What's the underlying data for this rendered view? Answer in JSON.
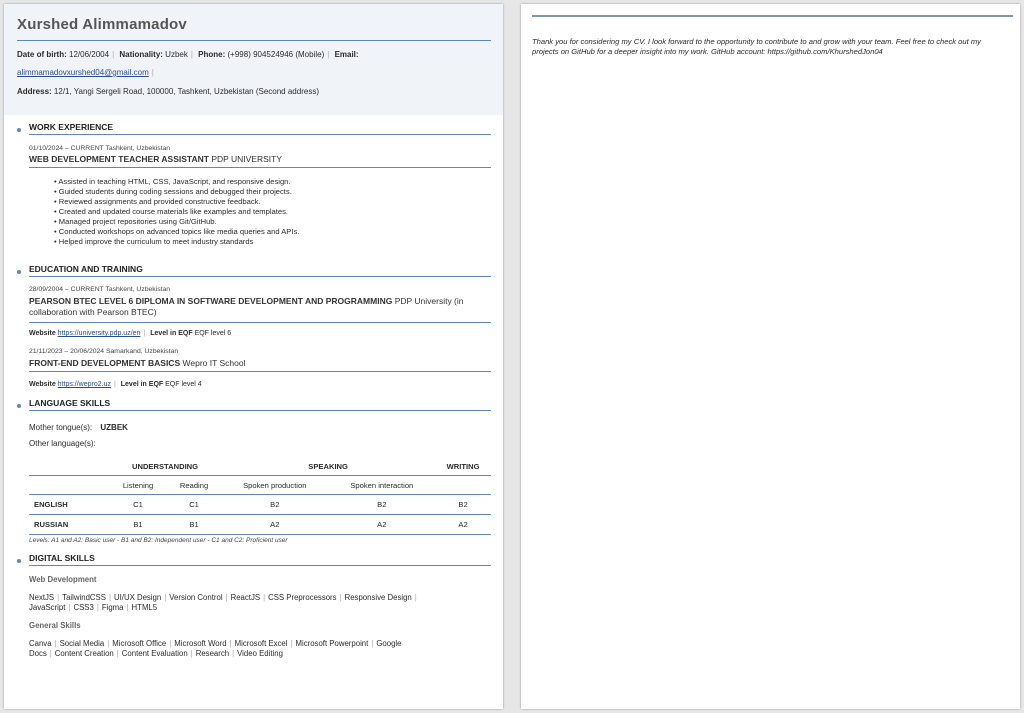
{
  "header": {
    "name": "Xurshed Alimmamadov",
    "dob_label": "Date of birth:",
    "dob": "12/06/2004",
    "nationality_label": "Nationality:",
    "nationality": "Uzbek",
    "phone_label": "Phone:",
    "phone": "(+998) 904524946 (Mobile)",
    "email_label": "Email:",
    "email": "alimmamadovxurshed04@gmail.com",
    "address_label": "Address:",
    "address": "12/1, Yangi Sergeli Road, 100000, Tashkent, Uzbekistan (Second address)"
  },
  "work": {
    "heading": "WORK EXPERIENCE",
    "date_place": "01/10/2024 – CURRENT Tashkent, Uzbekistan",
    "title": "WEB DEVELOPMENT TEACHER ASSISTANT",
    "org": "PDP UNIVERSITY",
    "bullets": [
      "Assisted in teaching HTML, CSS, JavaScript, and responsive design.",
      "Guided students during coding sessions and debugged their projects.",
      "Reviewed assignments and provided constructive feedback.",
      "Created and updated course materials like examples and templates.",
      "Managed project repositories using Git/GitHub.",
      "Conducted workshops on advanced topics like media queries and APIs.",
      "Helped improve the curriculum to meet industry standards"
    ]
  },
  "education": {
    "heading": "EDUCATION AND TRAINING",
    "items": [
      {
        "date_place": "28/09/2004 – CURRENT Tashkent, Uzbekistan",
        "title": "PEARSON BTEC LEVEL 6 DIPLOMA IN SOFTWARE DEVELOPMENT AND PROGRAMMING",
        "org_line1": "PDP University (in",
        "org_line2": "collaboration with Pearson BTEC)",
        "website_label": "Website",
        "website": "https://university.pdp.uz/en",
        "eqf_label": "Level in EQF",
        "eqf": "EQF level 6"
      },
      {
        "date_place": "21/11/2023 – 20/06/2024 Samarkand, Uzbekistan",
        "title": "FRONT-END DEVELOPMENT BASICS",
        "org": "Wepro IT School",
        "website_label": "Website",
        "website": "https://wepro2.uz",
        "eqf_label": "Level in EQF",
        "eqf": "EQF level 4"
      }
    ]
  },
  "languages": {
    "heading": "LANGUAGE SKILLS",
    "mother_label": "Mother tongue(s):",
    "mother": "UZBEK",
    "other_label": "Other language(s):",
    "groups": [
      "UNDERSTANDING",
      "SPEAKING",
      "WRITING"
    ],
    "subheads": [
      "Listening",
      "Reading",
      "Spoken production",
      "Spoken interaction"
    ],
    "rows": [
      {
        "lang": "ENGLISH",
        "values": [
          "C1",
          "C1",
          "B2",
          "B2",
          "B2"
        ]
      },
      {
        "lang": "RUSSIAN",
        "values": [
          "B1",
          "B1",
          "A2",
          "A2",
          "A2"
        ]
      }
    ],
    "levels_note": "Levels: A1 and A2: Basic user - B1 and B2: Independent user - C1 and C2: Proficient user"
  },
  "digital": {
    "heading": "DIGITAL SKILLS",
    "web_heading": "Web Development",
    "web_line1": [
      "NextJS",
      "TailwindCSS",
      "UI/UX Design",
      "Version Control",
      "ReactJS",
      "CSS Preprocessors",
      "Responsive Design"
    ],
    "web_line2": [
      "JavaScript",
      "CSS3",
      "Figma",
      "HTML5"
    ],
    "general_heading": "General Skills",
    "general_line1": [
      "Canva",
      "Social Media",
      "Microsoft Office",
      "Microsoft Word",
      "Microsoft Excel",
      "Microsoft Powerpoint",
      "Google"
    ],
    "general_line2": [
      "Docs",
      "Content Creation",
      "Content Evaluation",
      "Research",
      "Video Editing"
    ]
  },
  "page2": {
    "closing": "Thank you for considering my CV. I look forward to the opportunity to contribute to and grow with your team. Feel free to check out my projects on GitHub for a deeper insight into my work. GitHub account: https://github.com/KhurshedJon04"
  },
  "colors": {
    "accent": "#5f87b7",
    "header_bg": "#f0f4f9",
    "link": "#2a4d8f"
  }
}
